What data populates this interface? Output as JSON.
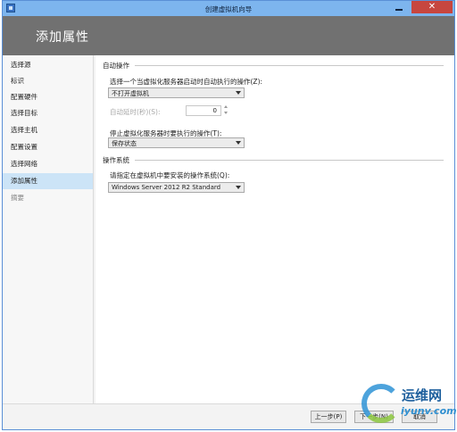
{
  "window": {
    "title": "创建虚拟机向导",
    "close_glyph": "✕",
    "header_title": "添加属性"
  },
  "sidebar": {
    "items": [
      {
        "label": "选择源"
      },
      {
        "label": "标识"
      },
      {
        "label": "配置硬件"
      },
      {
        "label": "选择目标"
      },
      {
        "label": "选择主机"
      },
      {
        "label": "配置设置"
      },
      {
        "label": "选择网络"
      },
      {
        "label": "添加属性",
        "active": true
      },
      {
        "label": "摘要"
      }
    ]
  },
  "auto_actions": {
    "section_title": "自动操作",
    "start_label": "选择一个当虚拟化服务器启动时自动执行的操作(Z):",
    "start_value": "不打开虚拟机",
    "delay_label": "自动延时(秒)(S):",
    "delay_value": "0",
    "stop_label": "停止虚拟化服务器时要执行的操作(T):",
    "stop_value": "保存状态"
  },
  "os": {
    "section_title": "操作系统",
    "label": "请指定在虚拟机中要安装的操作系统(Q):",
    "value": "Windows Server 2012 R2 Standard"
  },
  "footer": {
    "back_label": "上一步(P)",
    "next_label": "下一步(N)",
    "cancel_label": "取消"
  },
  "watermark": {
    "cn": "运维网",
    "en": "iyunv.com"
  },
  "colors": {
    "titlebar": "#7db5ee",
    "header": "#717171",
    "active_item": "#cce4f7",
    "close_button": "#c7463f"
  }
}
